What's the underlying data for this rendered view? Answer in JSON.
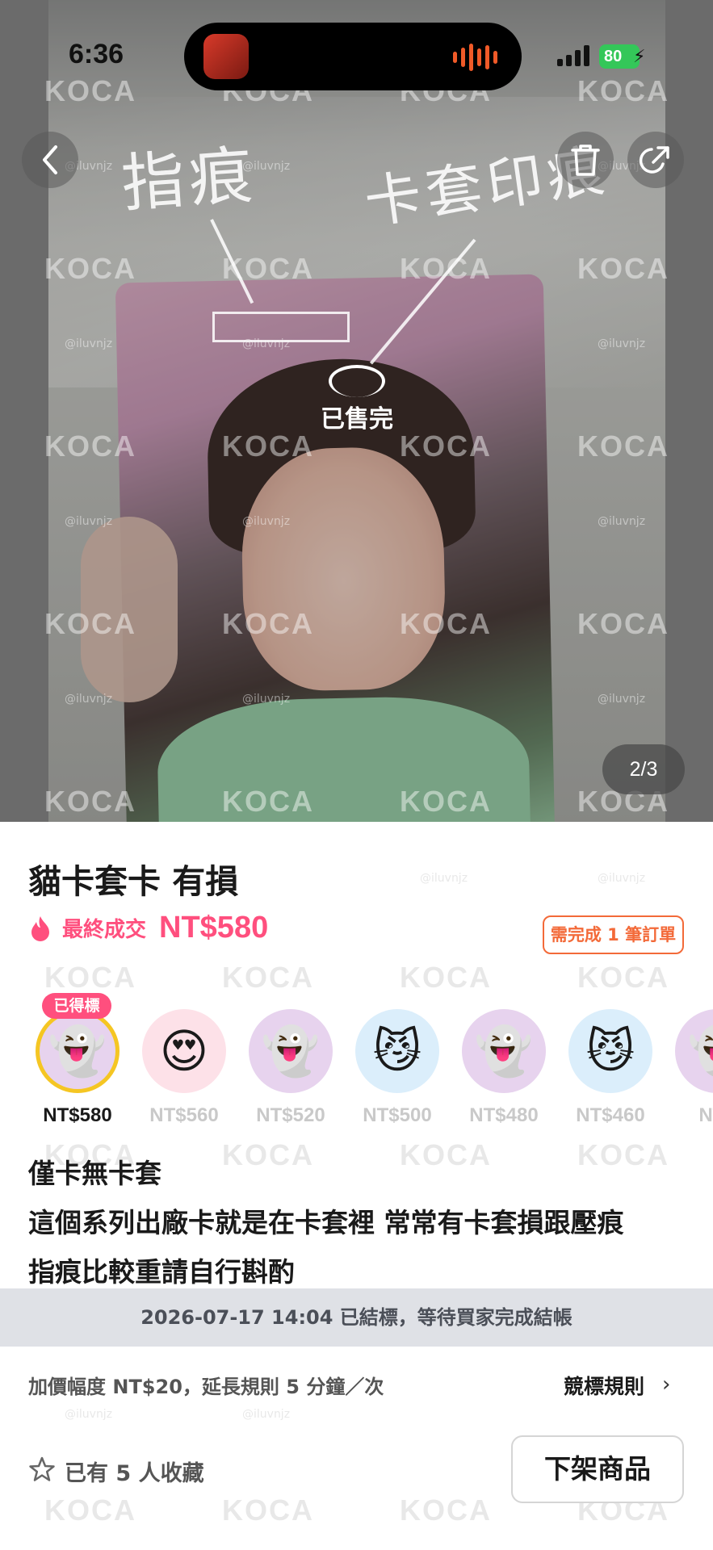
{
  "status_bar": {
    "time": "6:36",
    "battery": "80"
  },
  "hero": {
    "annotation_left": "指痕",
    "annotation_right": "卡套印痕",
    "sold_stamp": "已售完",
    "watermark_text": "KOCA",
    "watermark_handle": "@iluvnjz",
    "page_counter": "2/3"
  },
  "listing": {
    "title": "貓卡套卡 有損",
    "price_label": "最終成交",
    "price_value": "NT$580",
    "order_badge": "需完成 1 筆訂單"
  },
  "bidders": [
    {
      "amount": "NT$580",
      "emoji": "👻",
      "bg": "#e7d3ee",
      "winner": true,
      "tag": "已得標"
    },
    {
      "amount": "NT$560",
      "emoji": "😍",
      "bg": "#fde1e8"
    },
    {
      "amount": "NT$520",
      "emoji": "👻",
      "bg": "#e7d3ee"
    },
    {
      "amount": "NT$500",
      "emoji": "😼",
      "bg": "#dbeefb"
    },
    {
      "amount": "NT$480",
      "emoji": "👻",
      "bg": "#e7d3ee"
    },
    {
      "amount": "NT$460",
      "emoji": "😼",
      "bg": "#dbeefb"
    },
    {
      "amount": "NT$",
      "emoji": "👻",
      "bg": "#e7d3ee"
    }
  ],
  "description": {
    "line1": "僅卡無卡套",
    "line2": "這個系列出廠卡就是在卡套裡 常常有卡套損跟壓痕",
    "line3": "指痕比較重請自行斟酌"
  },
  "ended_notice": "2026-07-17 14:04 已結標，等待買家完成結帳",
  "rules": {
    "increment_text": "加價幅度 NT$20，延長規則 5 分鐘／次",
    "rules_link": "競標規則"
  },
  "footer": {
    "favorites_text": "已有 5 人收藏",
    "unlist_button": "下架商品"
  },
  "colors": {
    "accent_pink": "#ff4f7e",
    "accent_orange": "#f36a39",
    "winner_ring": "#f5c623",
    "battery_green": "#34c759"
  }
}
